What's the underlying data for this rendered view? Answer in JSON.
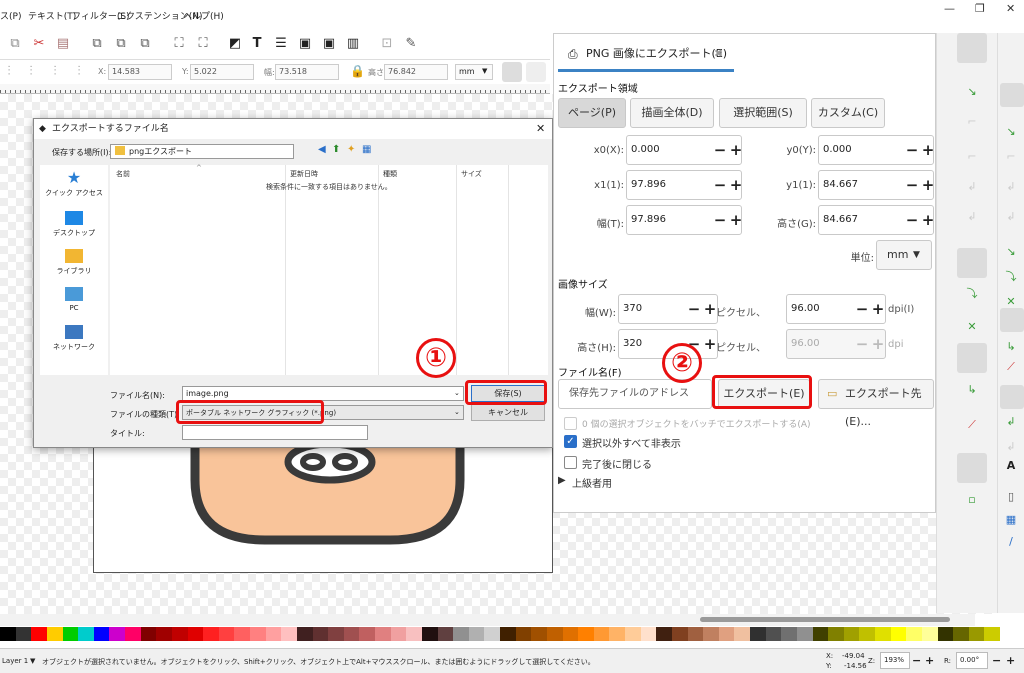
{
  "menu": {
    "items": [
      "ス(P)",
      "テキスト(T)",
      "フィルター(S)",
      "エクステンション(N)",
      "ヘルプ(H)"
    ]
  },
  "controls": {
    "x_label": "X:",
    "x_value": "14.583",
    "y_label": "Y:",
    "y_value": "5.022",
    "w_label": "幅:",
    "w_value": "73.518",
    "h_label": "高さ:",
    "h_value": "76.842",
    "unit": "mm"
  },
  "file_dialog": {
    "title": "エクスポートするファイル名",
    "location_label": "保存する場所(I):",
    "location_value": "pngエクスポート",
    "places": [
      "クイック アクセス",
      "デスクトップ",
      "ライブラリ",
      "PC",
      "ネットワーク"
    ],
    "columns": [
      "名前",
      "更新日時",
      "種類",
      "サイズ"
    ],
    "empty_message": "検索条件に一致する項目はありません。",
    "filename_label": "ファイル名(N):",
    "filename_value": "image.png",
    "filetype_label": "ファイルの種類(T):",
    "filetype_value": "ポータブル ネットワーク グラフィック (*.png)",
    "title_label": "タイトル:",
    "save_button": "保存(S)",
    "cancel_button": "キャンセル"
  },
  "export_panel": {
    "tab_label": "PNG 画像にエクスポート(E)",
    "area_heading": "エクスポート領域",
    "area_buttons": [
      "ページ(P)",
      "描画全体(D)",
      "選択範囲(S)",
      "カスタム(C)"
    ],
    "x0_label": "x0(X):",
    "x0_value": "0.000",
    "y0_label": "y0(Y):",
    "y0_value": "0.000",
    "x1_label": "x1(1):",
    "x1_value": "97.896",
    "y1_label": "y1(1):",
    "y1_value": "84.667",
    "width_label": "幅(T):",
    "width_value": "97.896",
    "height_label": "高さ(G):",
    "height_value": "84.667",
    "unit_label": "単位:",
    "unit_value": "mm",
    "image_size_heading": "画像サイズ",
    "img_w_label": "幅(W):",
    "img_w_value": "370",
    "px_label_1": "ピクセル、",
    "dpi_value": "96.00",
    "dpi_label": "dpi(I)",
    "img_h_label": "高さ(H):",
    "img_h_value": "320",
    "px_label_2": "ピクセル、",
    "dpi_value_2": "96.00",
    "dpi_label_2": "dpi",
    "filename_heading": "ファイル名(F)",
    "filename_placeholder": "保存先ファイルのアドレス",
    "export_button": "エクスポート(E)",
    "export_as_button": "エクスポート先(E)...",
    "check_batch": "0 個の選択オブジェクトをバッチでエクスポートする(A)",
    "check_hide": "選択以外すべて非表示",
    "check_close": "完了後に閉じる",
    "advanced": "上級者用"
  },
  "annotations": {
    "marker1": "①",
    "marker2": "②"
  },
  "status": {
    "layer": "Layer 1",
    "message": "オブジェクトが選択されていません。オブジェクトをクリック、Shift+クリック、オブジェクト上でAlt+マウススクロール、または囲むようにドラッグして選択してください。",
    "x_label": "X:",
    "x_value": "-49.04",
    "y_label": "Y:",
    "y_value": "-14.56",
    "zoom_label": "Z:",
    "zoom_value": "193%",
    "rotate_label": "R:",
    "rotate_value": "0.00°"
  },
  "colors": {
    "accent_red": "#e81010",
    "tab_accent": "#3b82c4",
    "face_fill": "#f9c49a"
  },
  "palette": [
    "#000000",
    "#333333",
    "#ff0000",
    "#ffcc00",
    "#00cc00",
    "#00cccc",
    "#0000ff",
    "#cc00cc",
    "#ff0066",
    "#800000",
    "#a00000",
    "#c00000",
    "#e00000",
    "#ff2020",
    "#ff4040",
    "#ff6060",
    "#ff8080",
    "#ffa0a0",
    "#ffc0c0",
    "#402020",
    "#603030",
    "#804040",
    "#a05050",
    "#c06060",
    "#e08080",
    "#f0a0a0",
    "#f8c0c0",
    "#201010",
    "#604040",
    "#909090",
    "#b0b0b0",
    "#d0d0d0",
    "#402000",
    "#804000",
    "#a05000",
    "#c06000",
    "#e07000",
    "#ff8000",
    "#ff9933",
    "#ffb366",
    "#ffcc99",
    "#ffe0cc",
    "#402010",
    "#804020",
    "#a06040",
    "#c08060",
    "#e0a080",
    "#f0c0a0",
    "#303030",
    "#505050",
    "#707070",
    "#909090",
    "#404000",
    "#808000",
    "#a0a000",
    "#c0c000",
    "#e0e000",
    "#ffff00",
    "#ffff66",
    "#ffff99",
    "#333300",
    "#666600",
    "#999900",
    "#cccc00"
  ]
}
